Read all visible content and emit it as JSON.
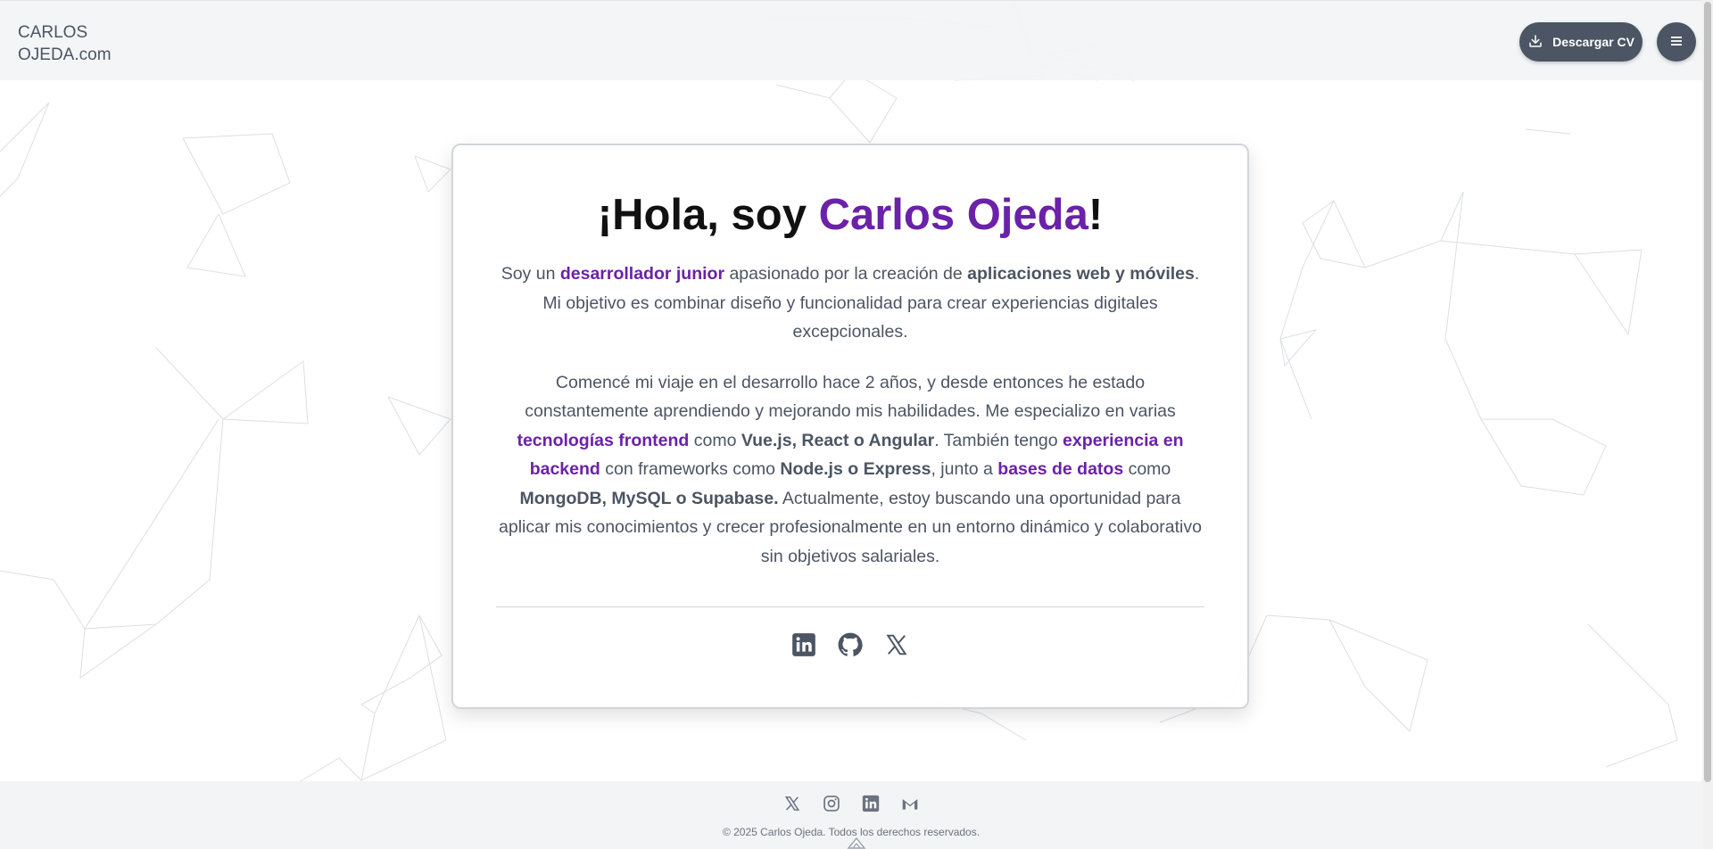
{
  "header": {
    "brand_line1": "CARLOS",
    "brand_line2": "OJEDA.com",
    "cv_button_label": "Descargar CV"
  },
  "hero": {
    "title_prefix": "¡Hola, soy ",
    "title_name": "Carlos Ojeda",
    "title_suffix": "!",
    "p1": [
      {
        "t": "Soy un ",
        "s": "plain"
      },
      {
        "t": "desarrollador junior",
        "s": "hl"
      },
      {
        "t": " apasionado por la creación de ",
        "s": "plain"
      },
      {
        "t": "aplicaciones web y móviles",
        "s": "b"
      },
      {
        "t": ". Mi objetivo es combinar diseño y funcionalidad para crear experiencias digitales excepcionales.",
        "s": "plain"
      }
    ],
    "p2": [
      {
        "t": "Comencé mi viaje en el desarrollo hace 2 años, y desde entonces he estado constantemente aprendiendo y mejorando mis habilidades. Me especializo en varias ",
        "s": "plain"
      },
      {
        "t": "tecnologías frontend",
        "s": "hl"
      },
      {
        "t": " como ",
        "s": "plain"
      },
      {
        "t": "Vue.js, React o Angular",
        "s": "b"
      },
      {
        "t": ". También tengo ",
        "s": "plain"
      },
      {
        "t": "experiencia en backend",
        "s": "hl"
      },
      {
        "t": " con frameworks como ",
        "s": "plain"
      },
      {
        "t": "Node.js o Express",
        "s": "b"
      },
      {
        "t": ", junto a ",
        "s": "plain"
      },
      {
        "t": "bases de datos",
        "s": "hl"
      },
      {
        "t": " como ",
        "s": "plain"
      },
      {
        "t": "MongoDB, MySQL o Supabase.",
        "s": "b"
      },
      {
        "t": " Actualmente, estoy buscando una oportunidad para aplicar mis conocimientos y crecer profesionalmente en un entorno dinámico y colaborativo sin objetivos salariales.",
        "s": "plain"
      }
    ],
    "socials": [
      "linkedin-icon",
      "github-icon",
      "x-icon"
    ]
  },
  "footer": {
    "icons": [
      "x-icon",
      "instagram-icon",
      "linkedin-icon",
      "gmail-icon"
    ],
    "copyright": "© 2025 Carlos Ojeda. Todos los derechos reservados."
  },
  "colors": {
    "accent": "#6b21a8",
    "text": "#4b5563",
    "button_bg": "#4b5563"
  }
}
